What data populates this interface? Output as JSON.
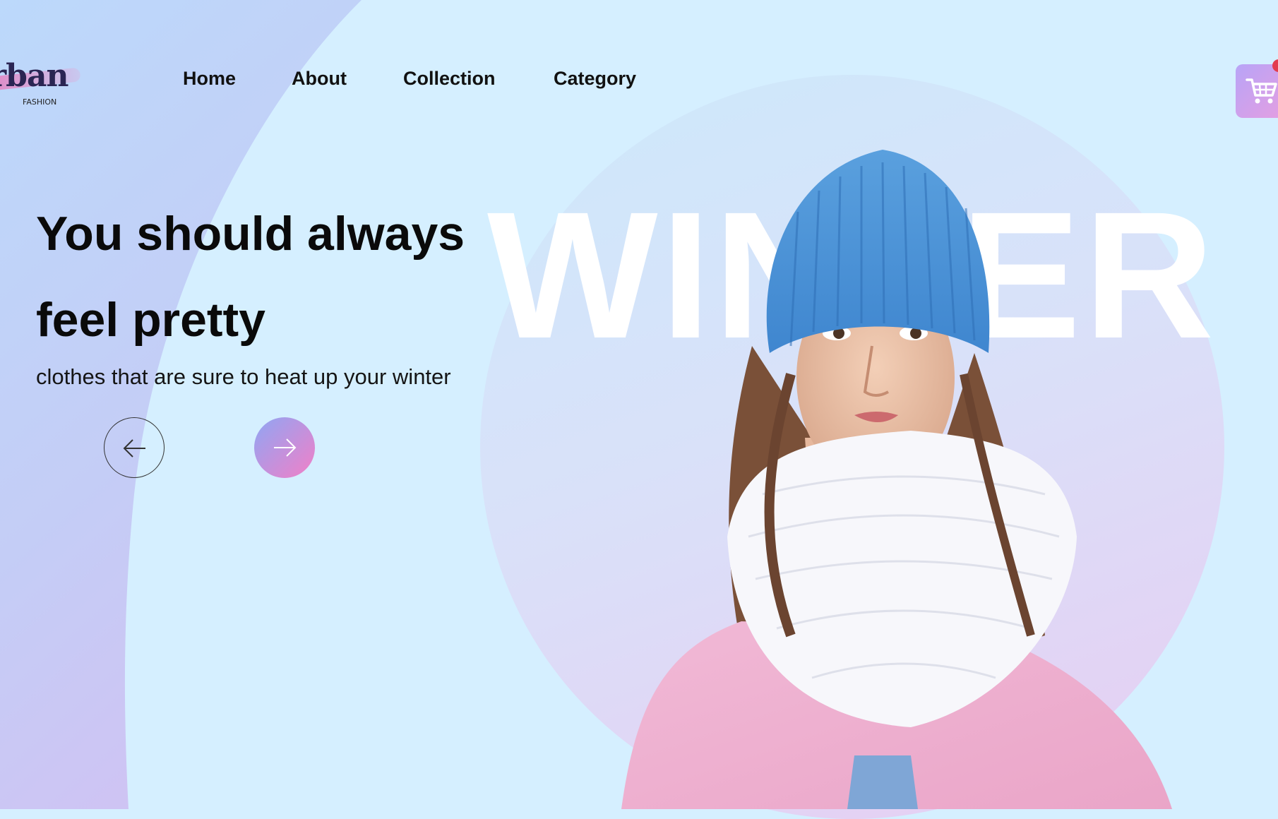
{
  "brand": {
    "logo_text": "rban",
    "logo_subtext": "FASHION"
  },
  "nav": {
    "items": [
      {
        "label": "Home"
      },
      {
        "label": "About"
      },
      {
        "label": "Collection"
      },
      {
        "label": "Category"
      }
    ]
  },
  "hero": {
    "headline_line1": "You should always",
    "headline_line2": "feel pretty",
    "subheadline": "clothes that are sure to heat up your winter",
    "watermark": "WINTER"
  },
  "icons": {
    "cart": "cart-icon",
    "prev": "arrow-left-icon",
    "next": "arrow-right-icon"
  },
  "colors": {
    "background": "#d5efff",
    "accent_gradient_start": "#8fa6f4",
    "accent_gradient_end": "#f27fc7",
    "cart_badge": "#e23c4e"
  }
}
